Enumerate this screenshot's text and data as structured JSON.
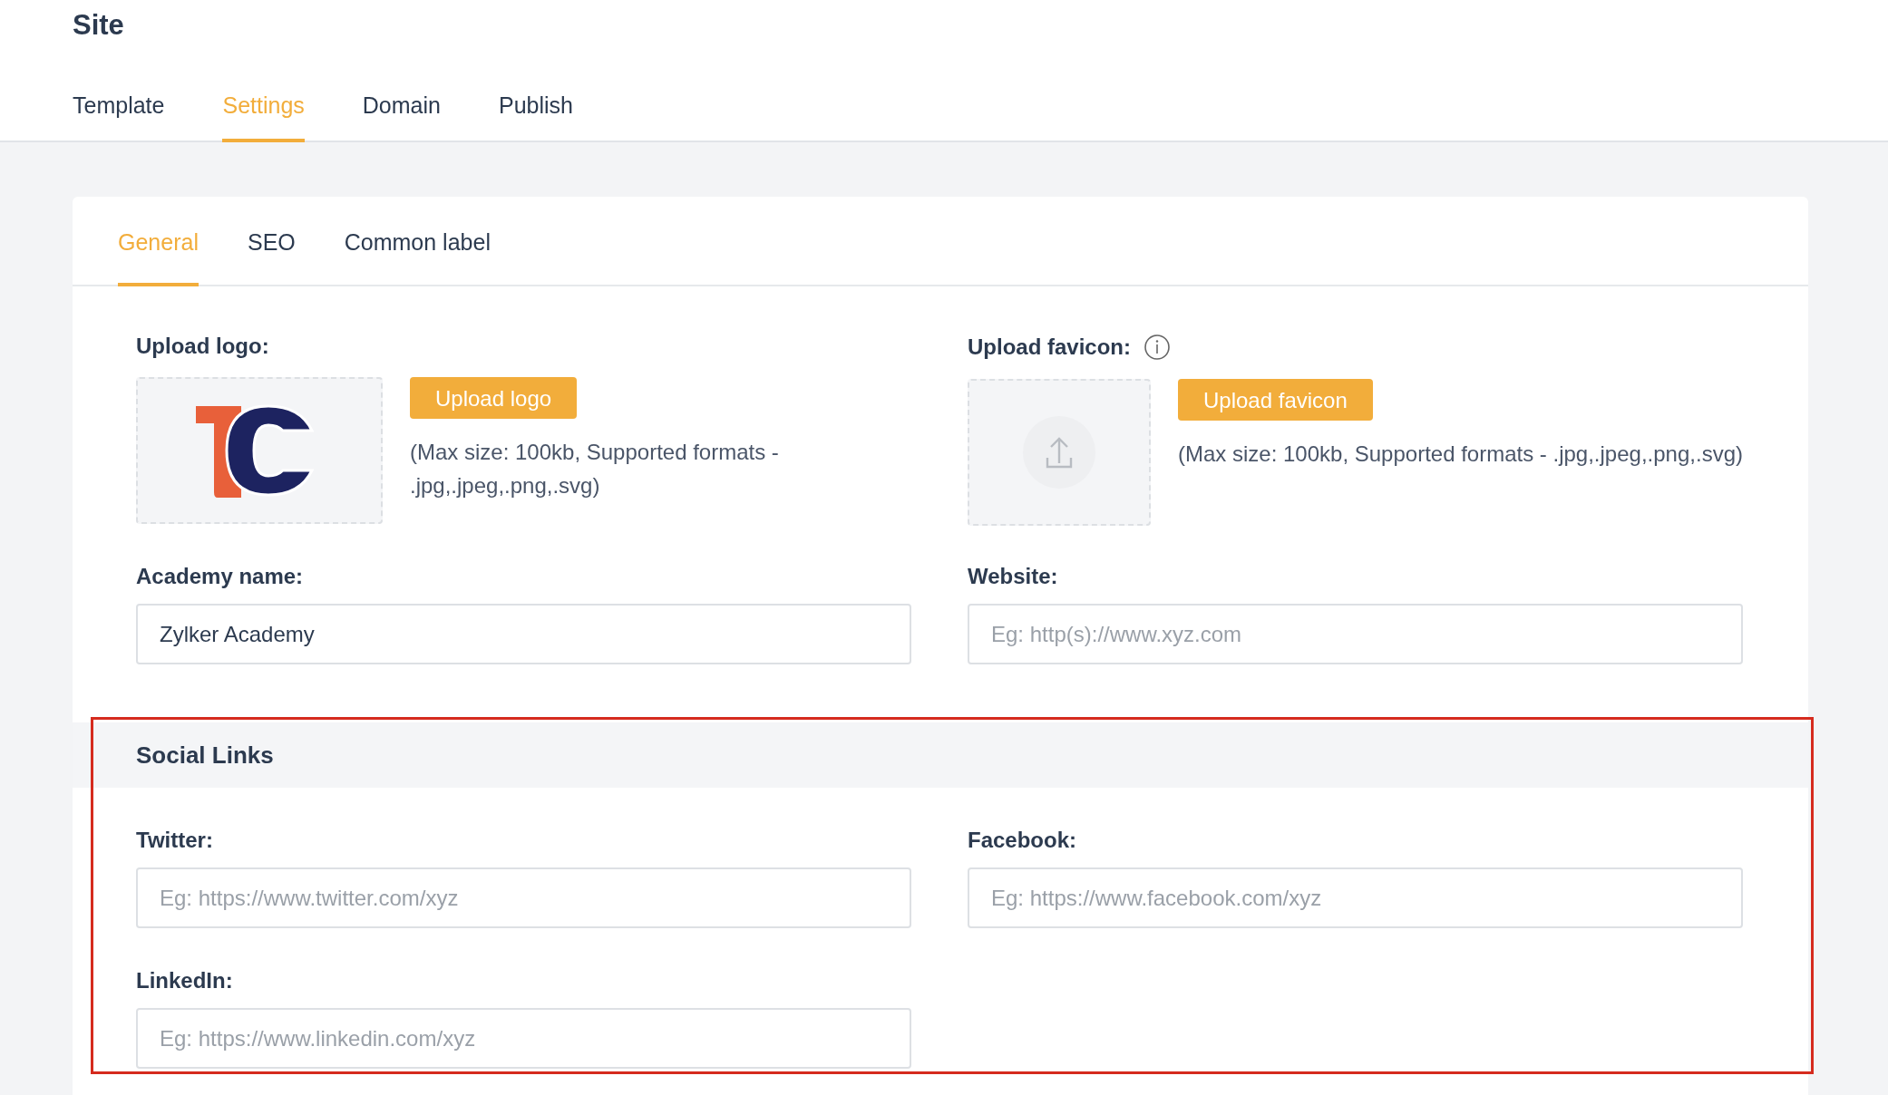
{
  "header": {
    "title": "Site"
  },
  "tabs": [
    {
      "label": "Template",
      "selected": false
    },
    {
      "label": "Settings",
      "selected": true
    },
    {
      "label": "Domain",
      "selected": false
    },
    {
      "label": "Publish",
      "selected": false
    }
  ],
  "subtabs": [
    {
      "label": "General",
      "selected": true
    },
    {
      "label": "SEO",
      "selected": false
    },
    {
      "label": "Common label",
      "selected": false
    }
  ],
  "uploads": [
    {
      "kind": "logo",
      "label": "Upload logo:",
      "info": false,
      "button": "Upload logo",
      "note": "(Max size: 100kb, Supported formats - .jpg,.jpeg,.png,.svg)"
    },
    {
      "kind": "favicon",
      "label": "Upload favicon:",
      "info": true,
      "button": "Upload favicon",
      "note": "(Max size: 100kb, Supported formats - .jpg,.jpeg,.png,.svg)"
    }
  ],
  "fields": [
    {
      "label": "Academy name:",
      "value": "Zylker Academy"
    },
    {
      "label": "Website:",
      "placeholder": "Eg: http(s)://www.xyz.com"
    }
  ],
  "social_links": {
    "title": "Social Links",
    "highlighted": true,
    "fields": [
      {
        "label": "Twitter:",
        "placeholder": "Eg: https://www.twitter.com/xyz"
      },
      {
        "label": "Facebook:",
        "placeholder": "Eg: https://www.facebook.com/xyz"
      },
      {
        "label": "LinkedIn:",
        "placeholder": "Eg: https://www.linkedin.com/xyz"
      }
    ]
  }
}
